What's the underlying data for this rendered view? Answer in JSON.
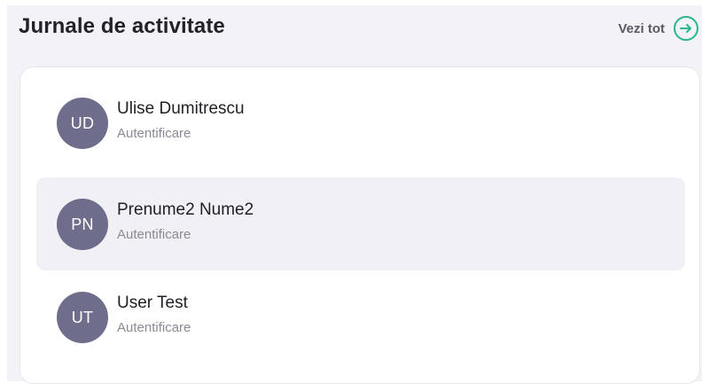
{
  "header": {
    "title": "Jurnale de activitate",
    "view_all_label": "Vezi tot",
    "view_all_icon": "arrow-right-circle-icon",
    "accent_color": "#2bb58a"
  },
  "activity": [
    {
      "initials": "UD",
      "name": "Ulise Dumitrescu",
      "action": "Autentificare",
      "highlighted": false
    },
    {
      "initials": "PN",
      "name": "Prenume2 Nume2",
      "action": "Autentificare",
      "highlighted": true
    },
    {
      "initials": "UT",
      "name": "User Test",
      "action": "Autentificare",
      "highlighted": false
    }
  ]
}
